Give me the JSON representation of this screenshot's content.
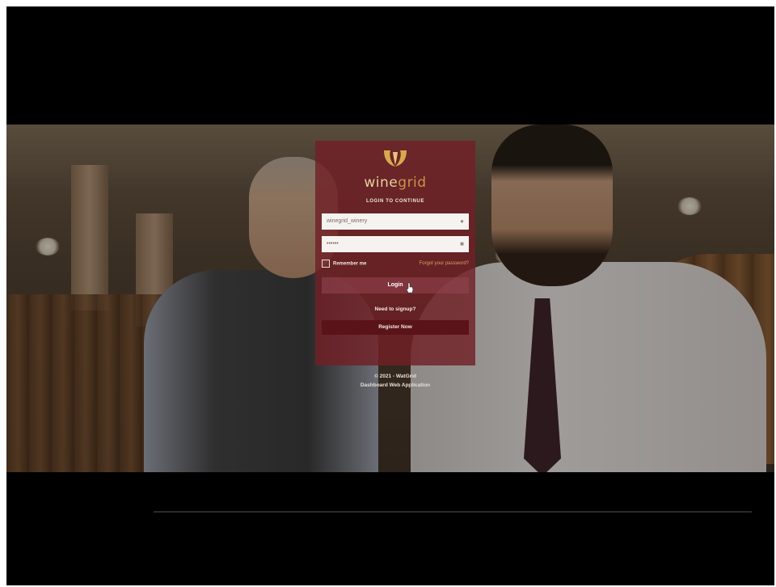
{
  "brand": {
    "logo_icon": "winegrid-logo-icon",
    "name_part1": "wine",
    "name_part2": "grid",
    "accent_color": "#d9b46a"
  },
  "login": {
    "subtitle": "LOGIN TO CONTINUE",
    "username_value": "winegrid_winery",
    "password_value": "••••••",
    "user_icon": "user-icon",
    "lock_icon": "lock-icon",
    "remember_label": "Remember me",
    "forgot_link": "Forgot your password?",
    "login_button": "Login",
    "need_signup": "Need to signup?",
    "register_button": "Register Now"
  },
  "footer": {
    "line1": "© 2021 - WatGrid",
    "line2": "Dashboard Web Application"
  },
  "colors": {
    "panel": "#702026",
    "register": "#5a1319",
    "link": "#d9a35e"
  }
}
